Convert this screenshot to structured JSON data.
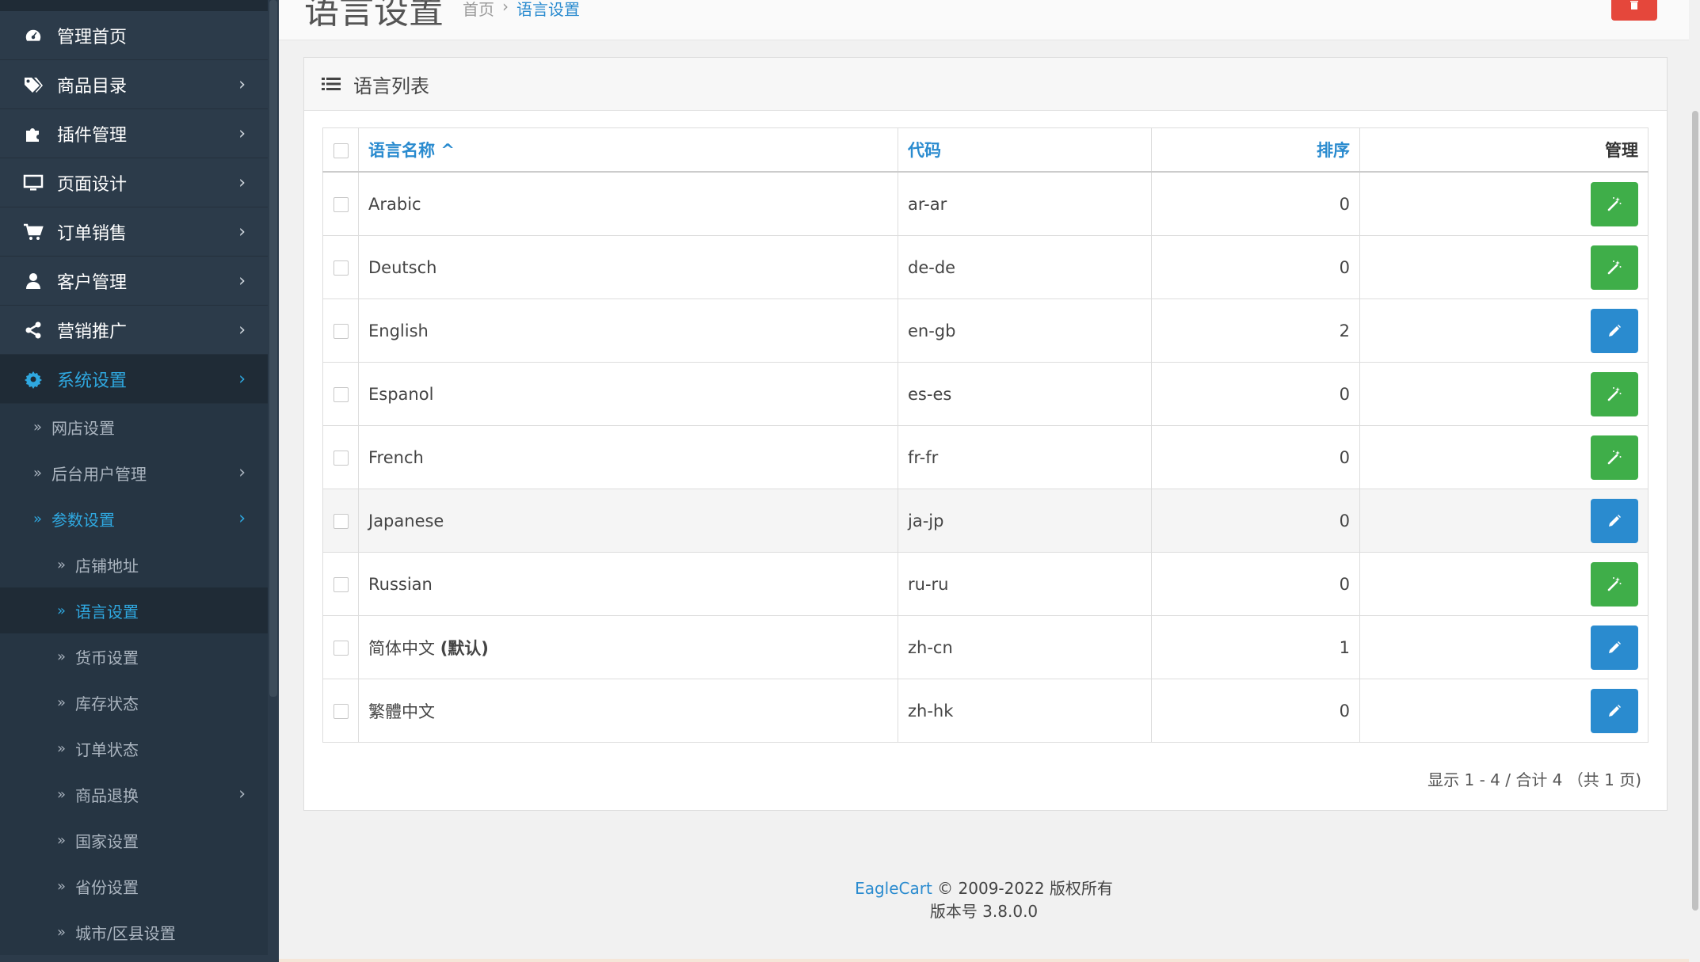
{
  "sidebar": {
    "items": [
      {
        "label": "管理首页",
        "icon": "dashboard-icon",
        "has_children": false,
        "active": false
      },
      {
        "label": "商品目录",
        "icon": "tags-icon",
        "has_children": true,
        "active": false
      },
      {
        "label": "插件管理",
        "icon": "puzzle-icon",
        "has_children": true,
        "active": false
      },
      {
        "label": "页面设计",
        "icon": "monitor-icon",
        "has_children": true,
        "active": false
      },
      {
        "label": "订单销售",
        "icon": "cart-icon",
        "has_children": true,
        "active": false
      },
      {
        "label": "客户管理",
        "icon": "user-icon",
        "has_children": true,
        "active": false
      },
      {
        "label": "营销推广",
        "icon": "share-icon",
        "has_children": true,
        "active": false
      },
      {
        "label": "系统设置",
        "icon": "gear-icon",
        "has_children": true,
        "active": true
      }
    ],
    "sub_items": [
      {
        "label": "网店设置",
        "level": 1,
        "has_children": false,
        "active": false
      },
      {
        "label": "后台用户管理",
        "level": 1,
        "has_children": true,
        "active": false
      },
      {
        "label": "参数设置",
        "level": 1,
        "has_children": true,
        "active": true
      },
      {
        "label": "店铺地址",
        "level": 2,
        "has_children": false,
        "active": false
      },
      {
        "label": "语言设置",
        "level": 2,
        "has_children": false,
        "active": true
      },
      {
        "label": "货币设置",
        "level": 2,
        "has_children": false,
        "active": false
      },
      {
        "label": "库存状态",
        "level": 2,
        "has_children": false,
        "active": false
      },
      {
        "label": "订单状态",
        "level": 2,
        "has_children": false,
        "active": false
      },
      {
        "label": "商品退换",
        "level": 2,
        "has_children": true,
        "active": false
      },
      {
        "label": "国家设置",
        "level": 2,
        "has_children": false,
        "active": false
      },
      {
        "label": "省份设置",
        "level": 2,
        "has_children": false,
        "active": false
      },
      {
        "label": "城市/区县设置",
        "level": 2,
        "has_children": false,
        "active": false
      }
    ]
  },
  "header": {
    "title": "语言设置",
    "breadcrumb": {
      "home": "首页",
      "separator": "›",
      "current": "语言设置"
    },
    "delete_icon": "trash-icon"
  },
  "panel": {
    "title": "语言列表",
    "title_icon": "list-icon"
  },
  "table": {
    "columns": {
      "name": "语言名称",
      "sort_indicator": "^",
      "code": "代码",
      "sort_order": "排序",
      "manage": "管理"
    },
    "rows": [
      {
        "name": "Arabic",
        "default_label": "",
        "code": "ar-ar",
        "sort": "0",
        "action": "install"
      },
      {
        "name": "Deutsch",
        "default_label": "",
        "code": "de-de",
        "sort": "0",
        "action": "install"
      },
      {
        "name": "English",
        "default_label": "",
        "code": "en-gb",
        "sort": "2",
        "action": "edit"
      },
      {
        "name": "Espanol",
        "default_label": "",
        "code": "es-es",
        "sort": "0",
        "action": "install"
      },
      {
        "name": "French",
        "default_label": "",
        "code": "fr-fr",
        "sort": "0",
        "action": "install"
      },
      {
        "name": "Japanese",
        "default_label": "",
        "code": "ja-jp",
        "sort": "0",
        "action": "edit"
      },
      {
        "name": "Russian",
        "default_label": "",
        "code": "ru-ru",
        "sort": "0",
        "action": "install"
      },
      {
        "name": "简体中文",
        "default_label": "(默认)",
        "code": "zh-cn",
        "sort": "1",
        "action": "edit"
      },
      {
        "name": "繁體中文",
        "default_label": "",
        "code": "zh-hk",
        "sort": "0",
        "action": "edit"
      }
    ],
    "pagination": "显示 1 - 4 / 合计 4 （共 1 页)"
  },
  "footer": {
    "brand": "EagleCart",
    "copyright": "© 2009-2022 版权所有",
    "version": "版本号 3.8.0.0"
  },
  "colors": {
    "sidebar_bg": "#2c3b4a",
    "accent": "#2a8bcf",
    "install_button": "#3fae49",
    "edit_button": "#2a8bcf",
    "danger_button": "#e5473b"
  }
}
